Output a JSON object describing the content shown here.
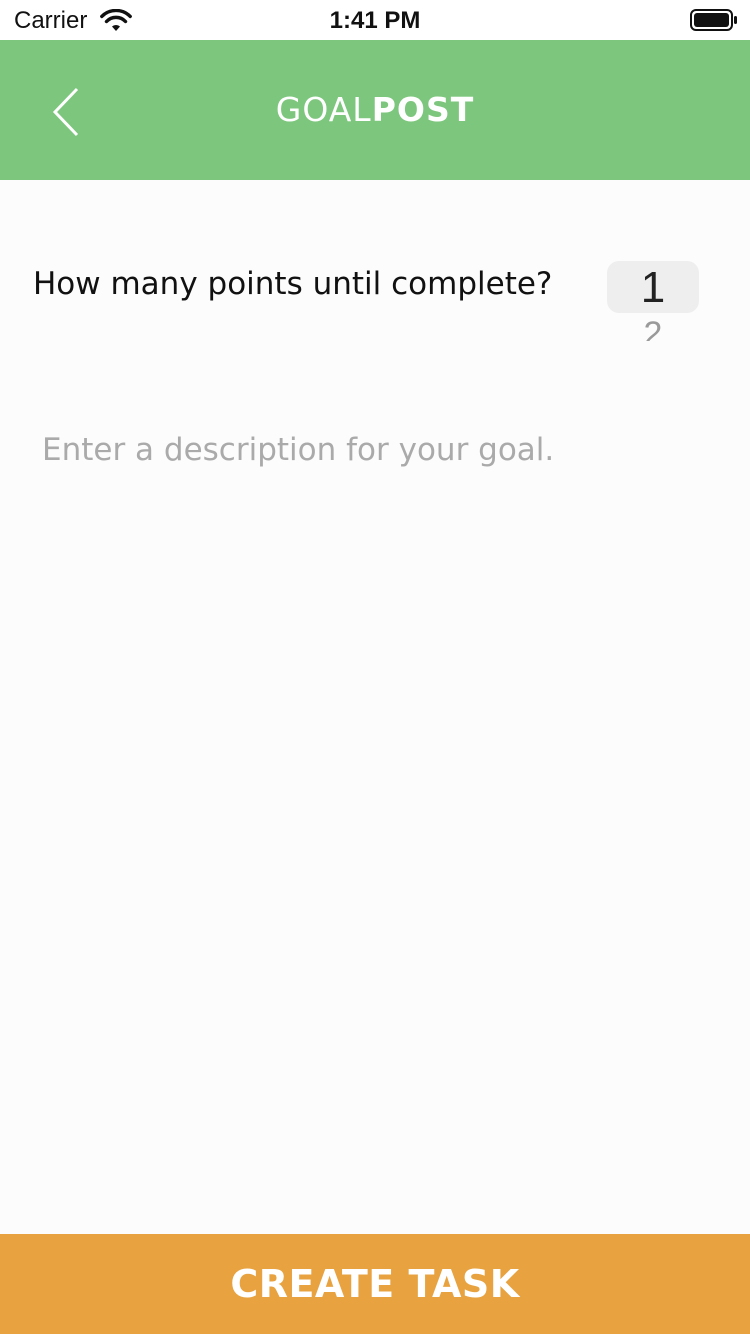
{
  "status_bar": {
    "carrier": "Carrier",
    "time": "1:41 PM"
  },
  "header": {
    "brand_light": "GOAL",
    "brand_bold": "POST",
    "back_icon": "chevron-left-icon",
    "background": "#7dc67d"
  },
  "points": {
    "question": "How many points until complete?",
    "selected_value": "1",
    "next_value": "2"
  },
  "description": {
    "placeholder": "Enter a description for your goal."
  },
  "footer": {
    "create_label": "CREATE TASK",
    "background": "#e8a340"
  }
}
